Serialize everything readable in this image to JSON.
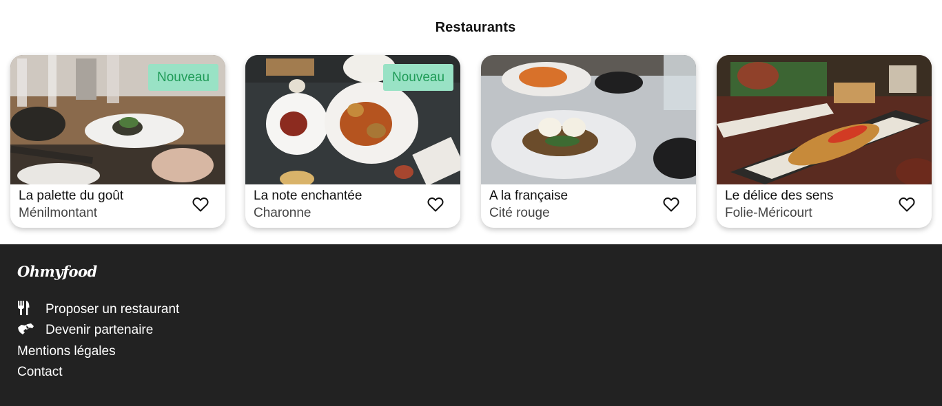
{
  "section": {
    "title": "Restaurants"
  },
  "restaurants": [
    {
      "name": "La palette du goût",
      "area": "Ménilmontant",
      "badge": "Nouveau",
      "icon": "heart-outline-icon"
    },
    {
      "name": "La note enchantée",
      "area": "Charonne",
      "badge": "Nouveau",
      "icon": "heart-outline-icon"
    },
    {
      "name": "A la française",
      "area": "Cité rouge",
      "badge": "",
      "icon": "heart-outline-icon"
    },
    {
      "name": "Le délice des sens",
      "area": "Folie-Méricourt",
      "badge": "",
      "icon": "heart-outline-icon"
    }
  ],
  "footer": {
    "brand": "Ohmyfood",
    "links": [
      {
        "label": "Proposer un restaurant",
        "icon": "utensils-icon"
      },
      {
        "label": "Devenir partenaire",
        "icon": "handshake-icon"
      },
      {
        "label": "Mentions légales"
      },
      {
        "label": "Contact"
      }
    ]
  },
  "colors": {
    "badge_bg": "#99e2c5",
    "badge_text": "#1f9b57",
    "footer_bg": "#222222"
  }
}
